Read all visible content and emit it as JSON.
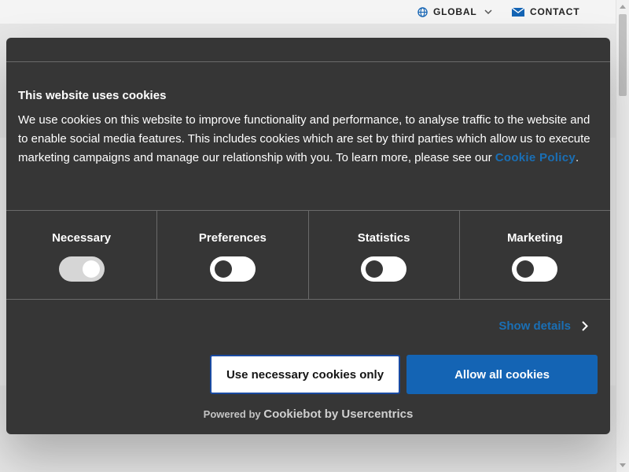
{
  "topbar": {
    "global_label": "GLOBAL",
    "contact_label": "CONTACT"
  },
  "dialog": {
    "title": "This website uses cookies",
    "body_pre": "We use cookies on this website to improve functionality and performance, to analyse traffic to the website and to enable social media features. This includes cookies which are set by third parties which allow us to execute marketing campaigns and manage our relationship with you. To learn more, please see our ",
    "policy_link": "Cookie Policy",
    "body_post": ".",
    "categories": [
      {
        "label": "Necessary",
        "enabled": true,
        "disabled": true
      },
      {
        "label": "Preferences",
        "enabled": false,
        "disabled": false
      },
      {
        "label": "Statistics",
        "enabled": false,
        "disabled": false
      },
      {
        "label": "Marketing",
        "enabled": false,
        "disabled": false
      }
    ],
    "show_details": "Show details",
    "btn_necessary": "Use necessary cookies only",
    "btn_allow": "Allow all cookies",
    "powered_prefix": "Powered by",
    "powered_brand": "Cookiebot by Usercentrics"
  },
  "colors": {
    "dialog_bg": "#363636",
    "accent_blue": "#1464b4",
    "link_blue": "#1a6fb5"
  }
}
